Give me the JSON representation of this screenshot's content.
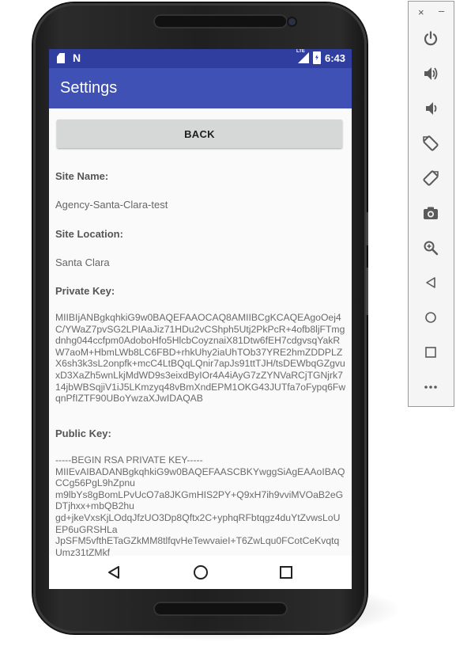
{
  "status_bar": {
    "time": "6:43",
    "network_label": "LTE",
    "icons": [
      "sim-icon",
      "n-icon",
      "lte-signal-icon",
      "battery-charging-icon"
    ]
  },
  "app_bar": {
    "title": "Settings"
  },
  "content": {
    "back_label": "BACK",
    "site_name_label": "Site Name:",
    "site_name_value": "Agency-Santa-Clara-test",
    "site_location_label": "Site Location:",
    "site_location_value": "Santa Clara",
    "private_key_label": "Private Key:",
    "private_key_value": "MIIBIjANBgkqhkiG9w0BAQEFAAOCAQ8AMIIBCgKCAQEAgoOej4C/YWaZ7pvSG2LPIAaJiz71HDu2vCShph5Utj2PkPcR+4ofb8ljFTmgdnhg044ccfpm0AdoboHfo5HlcbCoyznaiX81Dtw6fEH7cdgvsqYakRW7aoM+HbmLWb8LC6FBD+rhkUhy2iaUhTOb37YRE2hmZDDPLZX6sh3k3sL2onpfk+mcC4LtBQqLQnir7apJs91ttTJH/tsDEWbqGZgvuxD3XaZh5wnLkjMdWD9s3eixdByIOr4A4iAyG7zZYNVaRCjTGNjrk714jbWBSqjiV1iJ5LKmzyq48vBmXndEPM1OKG43JUTfa7oFypq6FwqnPfIZTF90UBoYwzaXJwIDAQAB",
    "public_key_label": "Public Key:",
    "public_key_value": "-----BEGIN RSA PRIVATE KEY-----\nMIIEvAIBADANBgkqhkiG9w0BAQEFAASCBKYwggSiAgEAAoIBAQCCg56PgL9hZpnu\nm9lbYs8gBomLPvUcO7a8JKGmHIS2PY+Q9xH7ih9vviMVOaB2eGDTjhxx+mbQB2hu\ngd+jkeVxsKjLOdqJfzUO3Dp8Qftx2C+yphqRFbtqgz4duYtZvwsLoUEP6uGRSHLa\nJpSFM5vfthETaGZkMM8tlfqvHeTewvaieI+T6ZwLqu0FCotCeKvqtqUmz31tZMkf"
  },
  "nav_bar": {
    "buttons": [
      "back-triangle-icon",
      "home-circle-icon",
      "recents-square-icon"
    ]
  },
  "emulator_panel": {
    "close_label": "×",
    "minimize_label": "–",
    "buttons": [
      "power-icon",
      "volume-up-icon",
      "volume-down-icon",
      "rotate-left-icon",
      "rotate-right-icon",
      "camera-icon",
      "zoom-icon",
      "back-icon",
      "home-icon",
      "overview-icon",
      "more-icon"
    ]
  },
  "colors": {
    "primary": "#3f51b5",
    "primary_dark": "#303f9f",
    "button_bg": "#d6d7d7",
    "label_text": "#555555",
    "value_text": "#666666",
    "emulator_icon": "#5a5a5a"
  }
}
